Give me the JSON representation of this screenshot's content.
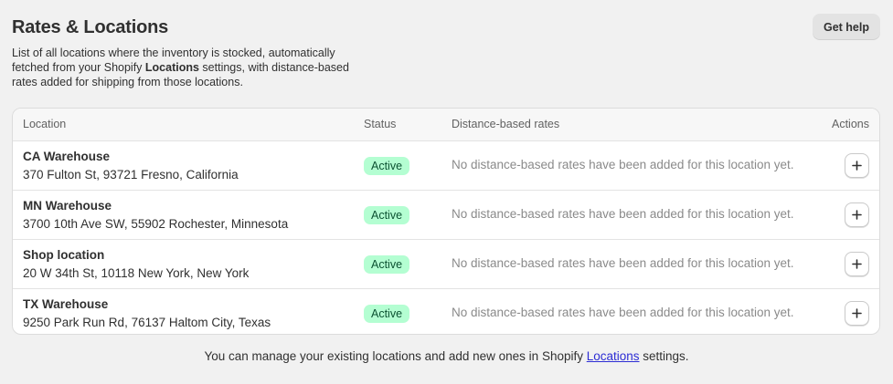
{
  "header": {
    "title": "Rates & Locations",
    "description_before": "List of all locations where the inventory is stocked, automatically fetched from your Shopify ",
    "description_bold": "Locations",
    "description_after": " settings, with distance-based rates added for shipping from those locations.",
    "help_button_label": "Get help"
  },
  "table": {
    "headers": {
      "location": "Location",
      "status": "Status",
      "rates": "Distance-based rates",
      "actions": "Actions"
    },
    "rows": [
      {
        "name": "CA Warehouse",
        "address": "370 Fulton St, 93721 Fresno, California",
        "status": "Active",
        "rates": "No distance-based rates have been added for this location yet.",
        "action_icon": "plus-icon"
      },
      {
        "name": "MN Warehouse",
        "address": "3700 10th Ave SW, 55902 Rochester, Minnesota",
        "status": "Active",
        "rates": "No distance-based rates have been added for this location yet.",
        "action_icon": "plus-icon"
      },
      {
        "name": "Shop location",
        "address": "20 W 34th St, 10118 New York, New York",
        "status": "Active",
        "rates": "No distance-based rates have been added for this location yet.",
        "action_icon": "plus-icon"
      },
      {
        "name": "TX Warehouse",
        "address": "9250 Park Run Rd, 76137 Haltom City, Texas",
        "status": "Active",
        "rates": "No distance-based rates have been added for this location yet.",
        "action_icon": "plus-icon"
      }
    ]
  },
  "footer": {
    "text_before": "You can manage your existing locations and add new ones in Shopify ",
    "link_label": "Locations",
    "text_after": " settings."
  },
  "colors": {
    "background": "#f1f1f1",
    "badge_bg": "#b4fed2",
    "badge_text": "#0c5132",
    "link": "#2c2cd4"
  }
}
